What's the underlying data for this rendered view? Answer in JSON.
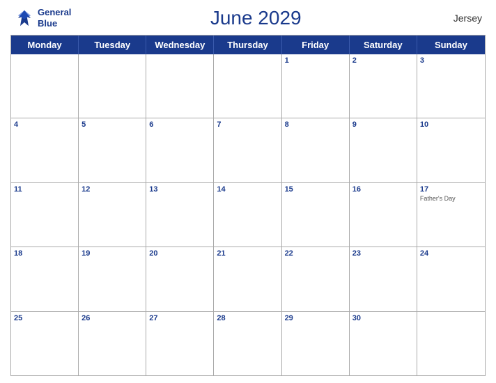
{
  "header": {
    "title": "June 2029",
    "region": "Jersey",
    "logo_line1": "General",
    "logo_line2": "Blue"
  },
  "weekdays": [
    "Monday",
    "Tuesday",
    "Wednesday",
    "Thursday",
    "Friday",
    "Saturday",
    "Sunday"
  ],
  "weeks": [
    [
      {
        "num": "",
        "empty": true
      },
      {
        "num": "",
        "empty": true
      },
      {
        "num": "",
        "empty": true
      },
      {
        "num": "",
        "empty": true
      },
      {
        "num": "1"
      },
      {
        "num": "2"
      },
      {
        "num": "3"
      }
    ],
    [
      {
        "num": "4"
      },
      {
        "num": "5"
      },
      {
        "num": "6"
      },
      {
        "num": "7"
      },
      {
        "num": "8"
      },
      {
        "num": "9"
      },
      {
        "num": "10"
      }
    ],
    [
      {
        "num": "11"
      },
      {
        "num": "12"
      },
      {
        "num": "13"
      },
      {
        "num": "14"
      },
      {
        "num": "15"
      },
      {
        "num": "16"
      },
      {
        "num": "17",
        "event": "Father's Day"
      }
    ],
    [
      {
        "num": "18"
      },
      {
        "num": "19"
      },
      {
        "num": "20"
      },
      {
        "num": "21"
      },
      {
        "num": "22"
      },
      {
        "num": "23"
      },
      {
        "num": "24"
      }
    ],
    [
      {
        "num": "25"
      },
      {
        "num": "26"
      },
      {
        "num": "27"
      },
      {
        "num": "28"
      },
      {
        "num": "29"
      },
      {
        "num": "30"
      },
      {
        "num": "",
        "empty": true
      }
    ]
  ]
}
